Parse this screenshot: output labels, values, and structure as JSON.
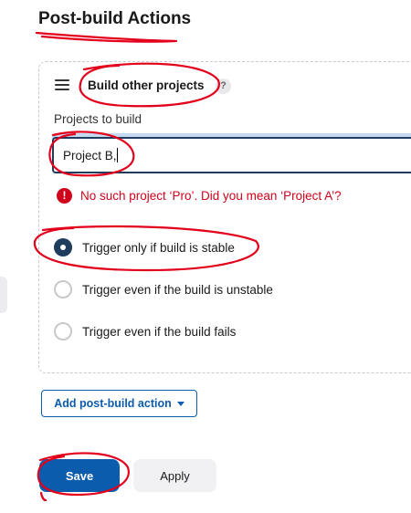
{
  "section": {
    "title": "Post-build Actions"
  },
  "build_step": {
    "title": "Build other projects",
    "help": "?",
    "projects_label": "Projects to build",
    "projects_value": "Project B,",
    "error_icon": "!",
    "error_message": "No such project ‘Pro’. Did you mean ‘Project A’?"
  },
  "trigger_options": [
    {
      "label": "Trigger only if build is stable",
      "checked": true
    },
    {
      "label": "Trigger even if the build is unstable",
      "checked": false
    },
    {
      "label": "Trigger even if the build fails",
      "checked": false
    }
  ],
  "actions": {
    "add_post_build": "Add post-build action",
    "save": "Save",
    "apply": "Apply"
  },
  "icons": {
    "drag_handle": "hamburger-icon",
    "help": "help-icon",
    "error": "error-icon",
    "dropdown": "caret-down-icon"
  },
  "colors": {
    "primary": "#0b5cad",
    "error": "#d0021b",
    "radio_selected": "#1f3c5e",
    "annotation": "#e3001b"
  }
}
